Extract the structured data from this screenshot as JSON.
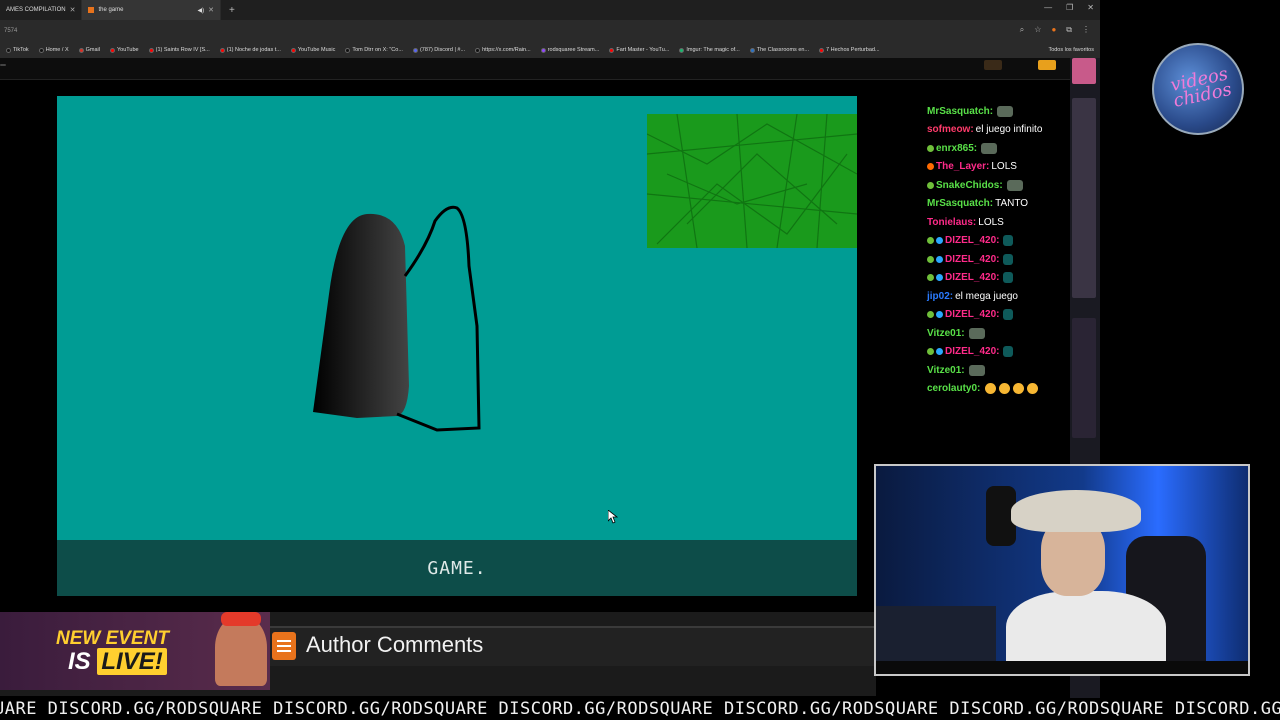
{
  "browser": {
    "tabs": [
      {
        "label": "AMES COMPILATION",
        "active": false
      },
      {
        "label": "the game",
        "active": true
      }
    ],
    "address_text": "7574",
    "bookmarks": [
      {
        "label": "TikTok",
        "color": "#111111"
      },
      {
        "label": "Home / X",
        "color": "#111111"
      },
      {
        "label": "Gmail",
        "color": "#d93025"
      },
      {
        "label": "YouTube",
        "color": "#ff0000"
      },
      {
        "label": "(1) Saints Row IV [S...",
        "color": "#ff0000"
      },
      {
        "label": "(1) Noche de jodas t...",
        "color": "#ff0000"
      },
      {
        "label": "YouTube Music",
        "color": "#ff0000"
      },
      {
        "label": "Tom Dtrr on X: \"Co...",
        "color": "#111111"
      },
      {
        "label": "(787) Discord | #...",
        "color": "#5865f2"
      },
      {
        "label": "https://x.com/Rain...",
        "color": "#111111"
      },
      {
        "label": "rodsquaree Stream...",
        "color": "#9146ff"
      },
      {
        "label": "Fart Master - YouTu...",
        "color": "#ff0000"
      },
      {
        "label": "Imgur: The magic of...",
        "color": "#1bb76e"
      },
      {
        "label": "The Classrooms en...",
        "color": "#2b73c6"
      },
      {
        "label": "7 Hechos Perturbad...",
        "color": "#ff0000"
      }
    ],
    "all_bookmarks_label": "Todos los favoritos"
  },
  "game": {
    "footer_text": "GAME.",
    "colors": {
      "background": "#009c94",
      "footer": "#0d4d49",
      "green_block": "#1a9a1c"
    }
  },
  "chat": {
    "messages": [
      {
        "user": "MrSasquatch:",
        "user_color": "#59e048",
        "text": "",
        "emote": true
      },
      {
        "user": "sofmeow:",
        "user_color": "#ff3b6b",
        "text": "el juego infinito"
      },
      {
        "user": "enrx865:",
        "user_color": "#59e048",
        "text": "",
        "badge": "#6fbf3a",
        "emote": true
      },
      {
        "user": "The_Layer:",
        "user_color": "#ff2b8a",
        "text": "LOLS",
        "badge": "#ff6a00"
      },
      {
        "user": "SnakeChidos:",
        "user_color": "#59e048",
        "text": "",
        "badge": "#6fbf3a",
        "emote": true
      },
      {
        "user": "MrSasquatch:",
        "user_color": "#59e048",
        "text": "TANTO"
      },
      {
        "user": "Tonielaus:",
        "user_color": "#ff2b8a",
        "text": "LOLS"
      },
      {
        "user": "DIZEL_420:",
        "user_color": "#ff2b8a",
        "text": "",
        "badge": "#6fbf3a",
        "teal": true
      },
      {
        "user": "DIZEL_420:",
        "user_color": "#ff2b8a",
        "text": "",
        "badge": "#6fbf3a",
        "teal": true
      },
      {
        "user": "DIZEL_420:",
        "user_color": "#ff2b8a",
        "text": "",
        "badge": "#6fbf3a",
        "teal": true
      },
      {
        "user": "jip02:",
        "user_color": "#2a7bff",
        "text": "el mega juego"
      },
      {
        "user": "DIZEL_420:",
        "user_color": "#ff2b8a",
        "text": "",
        "badge": "#6fbf3a",
        "teal": true
      },
      {
        "user": "Vitze01:",
        "user_color": "#59e048",
        "text": "",
        "emote": true
      },
      {
        "user": "DIZEL_420:",
        "user_color": "#ff2b8a",
        "text": "",
        "badge": "#6fbf3a",
        "teal": true
      },
      {
        "user": "Vitze01:",
        "user_color": "#59e048",
        "text": "",
        "emote": true
      },
      {
        "user": "cerolauty0:",
        "user_color": "#59e048",
        "text": "",
        "emojis": 4
      }
    ]
  },
  "author": {
    "title": "Author Comments"
  },
  "event_banner": {
    "line1": "NEW EVENT",
    "line2_prefix": "IS",
    "line2_highlight": "LIVE!"
  },
  "logo": {
    "text": "videos chidos"
  },
  "ticker": {
    "text": "UARE DISCORD.GG/RODSQUARE DISCORD.GG/RODSQUARE DISCORD.GG/RODSQUARE DISCORD.GG/RODSQUARE DISCORD.GG/RODSQUARE DISCORD.GG/RODSQ"
  }
}
